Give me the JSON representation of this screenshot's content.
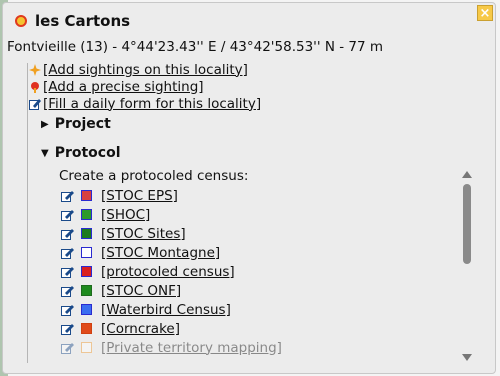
{
  "popup": {
    "title": "les Cartons",
    "coords": "Fontvieille (13) - 4°44'23.43'' E / 43°42'58.53'' N - 77 m",
    "close_label": "×"
  },
  "links": [
    {
      "label": "[Add sightings on this locality]",
      "icon": "star-plus-icon"
    },
    {
      "label": "[Add a precise sighting]",
      "icon": "pin-plus-icon"
    },
    {
      "label": "[Fill a daily form for this locality]",
      "icon": "edit-icon"
    }
  ],
  "sections": {
    "project": "Project",
    "protocol": "Protocol",
    "project_state": "collapsed",
    "protocol_state": "expanded"
  },
  "census_prompt": "Create a protocoled census:",
  "census_items": [
    {
      "label": "[STOC EPS]",
      "fill": "#d94040",
      "border": "#2a2ad0"
    },
    {
      "label": "[SHOC]",
      "fill": "#2c9a2c",
      "border": "#2a2ad0"
    },
    {
      "label": "[STOC Sites]",
      "fill": "#1e7a1e",
      "border": "#2a2ad0"
    },
    {
      "label": "[STOC Montagne]",
      "fill": "#ffffff",
      "border": "#2a2ad0"
    },
    {
      "label": "[protocoled census]",
      "fill": "#d92020",
      "border": "#2a2ad0"
    },
    {
      "label": "[STOC ONF]",
      "fill": "#1e8a1e",
      "border": "#1e6a1e"
    },
    {
      "label": "[Waterbird Census]",
      "fill": "#3a6df0",
      "border": "#2a2ad0"
    },
    {
      "label": "[Corncrake]",
      "fill": "#e04a1a",
      "border": "#d04010"
    },
    {
      "label": "[Private territory mapping]",
      "fill": "#ffffff",
      "border": "#f09a30"
    }
  ]
}
